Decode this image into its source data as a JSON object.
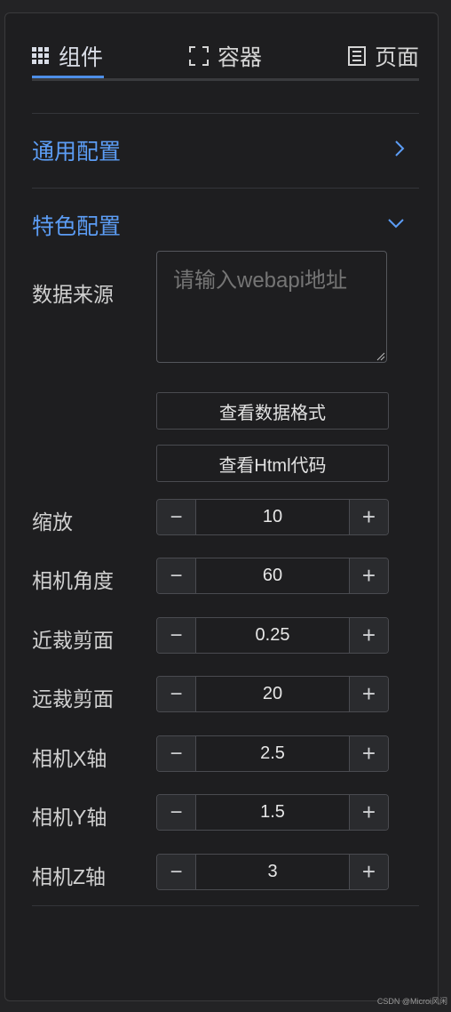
{
  "tabs": [
    {
      "label": "组件",
      "icon": "grid-icon",
      "active": true
    },
    {
      "label": "容器",
      "icon": "container-icon",
      "active": false
    },
    {
      "label": "页面",
      "icon": "page-icon",
      "active": false
    }
  ],
  "sections": {
    "general": {
      "title": "通用配置",
      "icon": "chevron-right-icon",
      "expanded": false
    },
    "featured": {
      "title": "特色配置",
      "icon": "chevron-down-icon",
      "expanded": true
    }
  },
  "data_source": {
    "label": "数据来源",
    "placeholder": "请输入webapi地址",
    "value": ""
  },
  "buttons": {
    "view_format": "查看数据格式",
    "view_html": "查看Html代码"
  },
  "params": [
    {
      "label": "缩放",
      "value": "10"
    },
    {
      "label": "相机角度",
      "value": "60"
    },
    {
      "label": "近裁剪面",
      "value": "0.25"
    },
    {
      "label": "远裁剪面",
      "value": "20"
    },
    {
      "label": "相机X轴",
      "value": "2.5"
    },
    {
      "label": "相机Y轴",
      "value": "1.5"
    },
    {
      "label": "相机Z轴",
      "value": "3"
    }
  ],
  "stepper_symbols": {
    "minus": "−",
    "plus": "+"
  },
  "colors": {
    "accent": "#4e8fe8",
    "section_title": "#5c9df5",
    "background": "#1e1e20"
  },
  "watermark": "CSDN @Microi风闲"
}
